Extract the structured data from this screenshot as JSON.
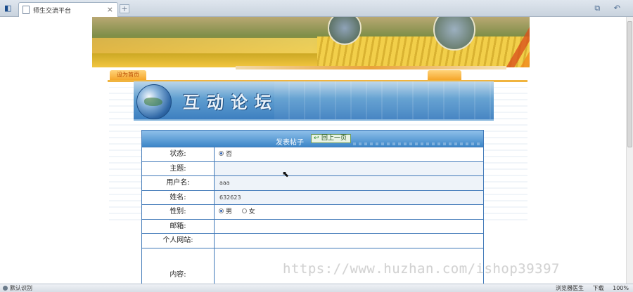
{
  "browser": {
    "tab_title": "师生交流平台",
    "tab_close": "×",
    "new_tab": "+",
    "app_icon": "◧",
    "right_icons": "⧉ ↶"
  },
  "page": {
    "left_tab_label": "设为首页",
    "forum_title": "互动论坛",
    "form_caption": "发表帖子",
    "back_button": "回上一页",
    "fields": [
      {
        "label": "状态:",
        "value": "否",
        "type": "radio-single"
      },
      {
        "label": "主题:",
        "value": "",
        "type": "text"
      },
      {
        "label": "用户名:",
        "value": "aaa",
        "type": "text"
      },
      {
        "label": "姓名:",
        "value": "632623",
        "type": "text"
      },
      {
        "label": "性别:",
        "options": [
          "男",
          "女"
        ],
        "selected": "男",
        "type": "radio"
      },
      {
        "label": "邮箱:",
        "value": "",
        "type": "text"
      },
      {
        "label": "个人网站:",
        "value": "",
        "type": "text"
      },
      {
        "label": "内容:",
        "value": "",
        "type": "textarea"
      }
    ]
  },
  "watermark": "https://www.huzhan.com/ishop39397",
  "statusbar": {
    "status": "默认识别",
    "accelerator": "浏览器医生",
    "download": "下载",
    "zoom": "100%"
  },
  "colors": {
    "accent": "#3c86c8",
    "border": "#3f78b8",
    "nav_orange": "#f0b43f"
  }
}
